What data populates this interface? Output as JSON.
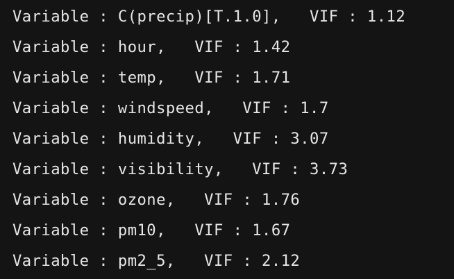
{
  "output": {
    "lines": [
      "Variable : C(precip)[T.1.0],   VIF : 1.12",
      "Variable : hour,   VIF : 1.42",
      "Variable : temp,   VIF : 1.71",
      "Variable : windspeed,   VIF : 1.7",
      "Variable : humidity,   VIF : 3.07",
      "Variable : visibility,   VIF : 3.73",
      "Variable : ozone,   VIF : 1.76",
      "Variable : pm10,   VIF : 1.67",
      "Variable : pm2_5,   VIF : 2.12"
    ]
  }
}
